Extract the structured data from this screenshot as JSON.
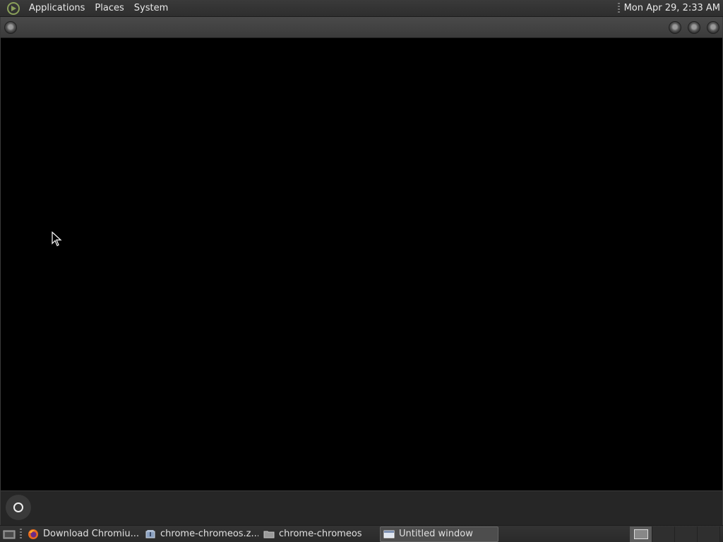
{
  "top_panel": {
    "menus": [
      "Applications",
      "Places",
      "System"
    ],
    "clock": "Mon Apr 29,  2:33 AM"
  },
  "window": {
    "title": ""
  },
  "taskbar": {
    "tasks": [
      {
        "label": "Download Chromiu...",
        "icon": "firefox-icon"
      },
      {
        "label": "chrome-chromeos.z...",
        "icon": "archive-icon"
      },
      {
        "label": "chrome-chromeos",
        "icon": "folder-icon"
      },
      {
        "label": "Untitled window",
        "icon": "window-icon",
        "active": true
      }
    ]
  },
  "colors": {
    "panel": "#2e2e2e",
    "client": "#000000",
    "active_task": "#4d4d4d"
  }
}
